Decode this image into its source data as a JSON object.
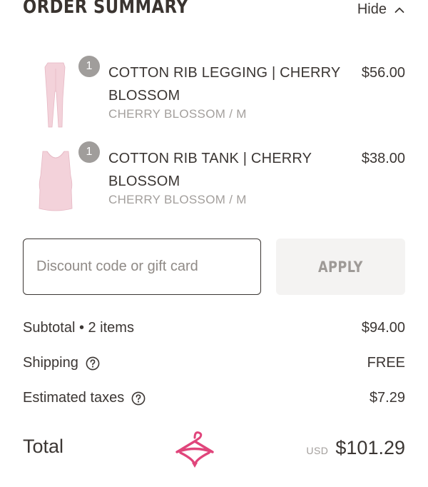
{
  "header": {
    "title": "ORDER SUMMARY",
    "toggle_label": "Hide"
  },
  "items": [
    {
      "quantity": "1",
      "name": "COTTON RIB LEGGING | CHERRY BLOSSOM",
      "variant": "CHERRY BLOSSOM / M",
      "price": "$56.00",
      "thumb_color": "#f3d2da"
    },
    {
      "quantity": "1",
      "name": "COTTON RIB TANK | CHERRY BLOSSOM",
      "variant": "CHERRY BLOSSOM / M",
      "price": "$38.00",
      "thumb_color": "#f3d2da"
    }
  ],
  "discount": {
    "placeholder": "Discount code or gift card",
    "value": "",
    "apply_label": "APPLY"
  },
  "summary": {
    "subtotal_label": "Subtotal • 2 items",
    "subtotal_value": "$94.00",
    "shipping_label": "Shipping",
    "shipping_value": "FREE",
    "taxes_label": "Estimated taxes",
    "taxes_value": "$7.29"
  },
  "total": {
    "label": "Total",
    "currency": "USD",
    "value": "$101.29"
  },
  "colors": {
    "text": "#3b3633",
    "muted": "#a39f9c",
    "badge": "#a09d9b",
    "apply_bg": "#f4f3f2",
    "logo_accent": "#e0457b"
  },
  "icons": {
    "toggle": "chevron-up-icon",
    "help": "question-circle-icon",
    "brand": "hanger-logo-icon"
  }
}
